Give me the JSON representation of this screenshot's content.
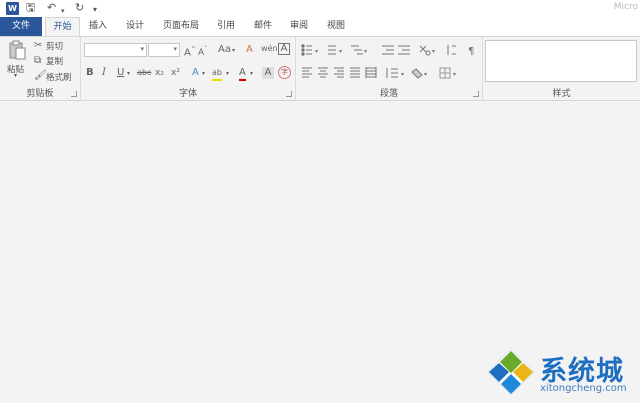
{
  "titlebar": {
    "logo_text": "W",
    "save_glyph": "🖫",
    "undo_glyph": "↶",
    "redo_glyph": "↻",
    "customize_glyph": "▾",
    "title": "Micro"
  },
  "tabs": [
    "文件",
    "开始",
    "插入",
    "设计",
    "页面布局",
    "引用",
    "邮件",
    "审阅",
    "视图"
  ],
  "clipboard": {
    "paste_label": "粘贴",
    "cut_label": "剪切",
    "copy_label": "复制",
    "format_painter_label": "格式刷",
    "group_label": "剪贴板"
  },
  "font": {
    "grow": "A",
    "shrink": "A",
    "change_case": "Aa",
    "clear": "A",
    "phonetic": "wén",
    "border": "A",
    "bold": "B",
    "italic": "I",
    "underline": "U",
    "strike": "abc",
    "subscript": "x₂",
    "superscript": "x²",
    "effects": "A",
    "highlight": "ab",
    "color": "A",
    "shading": "A",
    "enclose": "字",
    "group_label": "字体"
  },
  "paragraph": {
    "group_label": "段落"
  },
  "styles": {
    "group_label": "样式"
  },
  "watermark": {
    "text": "系统城",
    "url": "xitongcheng.com"
  },
  "colors": {
    "accent": "#2b579a",
    "watermark_blue": "#1e6fc2"
  }
}
